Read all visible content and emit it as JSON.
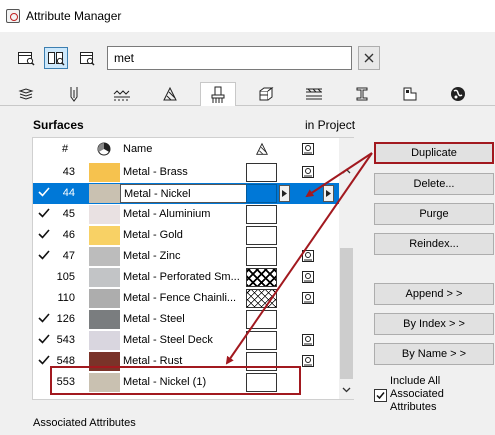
{
  "window": {
    "title": "Attribute Manager"
  },
  "toolbar": {
    "buttons": [
      {
        "icon": "left-panel-icon",
        "active": false
      },
      {
        "icon": "both-panels-icon",
        "active": true
      },
      {
        "icon": "right-panel-icon",
        "active": false
      }
    ],
    "search": {
      "value": "met",
      "placeholder": ""
    },
    "clear_icon": "close-icon"
  },
  "tabs": [
    {
      "icon": "layers-icon",
      "active": false
    },
    {
      "icon": "pens-icon",
      "active": false
    },
    {
      "icon": "line-types-icon",
      "active": false
    },
    {
      "icon": "fill-types-icon",
      "active": false
    },
    {
      "icon": "surfaces-icon",
      "active": true
    },
    {
      "icon": "building-materials-icon",
      "active": false
    },
    {
      "icon": "composites-icon",
      "active": false
    },
    {
      "icon": "profiles-icon",
      "active": false
    },
    {
      "icon": "zone-categories-icon",
      "active": false
    },
    {
      "icon": "markup-styles-icon",
      "active": false
    }
  ],
  "surfaces": {
    "heading": "Surfaces",
    "in_project_label": "in Project",
    "columns": {
      "number": "#",
      "name": "Name"
    },
    "rows": [
      {
        "checked": false,
        "number": "43",
        "name": "Metal - Brass",
        "color": "#f6c24e",
        "fill": "plain",
        "proj": true,
        "selected": false
      },
      {
        "checked": true,
        "number": "44",
        "name": "Metal - Nickel",
        "color": "#c9c1b1",
        "fill": "blue",
        "proj": false,
        "selected": true
      },
      {
        "checked": true,
        "number": "45",
        "name": "Metal - Aluminium",
        "color": "#e9e1e2",
        "fill": "plain",
        "proj": false,
        "selected": false
      },
      {
        "checked": true,
        "number": "46",
        "name": "Metal - Gold",
        "color": "#f8d165",
        "fill": "plain",
        "proj": false,
        "selected": false
      },
      {
        "checked": true,
        "number": "47",
        "name": "Metal - Zinc",
        "color": "#bcbcbc",
        "fill": "plain",
        "proj": true,
        "selected": false
      },
      {
        "checked": false,
        "number": "105",
        "name": "Metal - Perforated Sm...",
        "color": "#c2c4c6",
        "fill": "diamond",
        "proj": true,
        "selected": false
      },
      {
        "checked": false,
        "number": "110",
        "name": "Metal - Fence Chainli...",
        "color": "#adadad",
        "fill": "cross",
        "proj": true,
        "selected": false
      },
      {
        "checked": true,
        "number": "126",
        "name": "Metal - Steel",
        "color": "#7a7d7f",
        "fill": "plain",
        "proj": false,
        "selected": false
      },
      {
        "checked": true,
        "number": "543",
        "name": "Metal - Steel Deck",
        "color": "#d9d6df",
        "fill": "plain",
        "proj": true,
        "selected": false
      },
      {
        "checked": true,
        "number": "548",
        "name": "Metal - Rust",
        "color": "#7a3329",
        "fill": "plain",
        "proj": true,
        "selected": false
      },
      {
        "checked": false,
        "number": "553",
        "name": "Metal - Nickel (1)",
        "color": "#c9c1b1",
        "fill": "plain",
        "proj": false,
        "selected": false
      }
    ]
  },
  "actions": {
    "duplicate": "Duplicate",
    "delete": "Delete...",
    "purge": "Purge",
    "reindex": "Reindex...",
    "append": "Append > >",
    "by_index": "By Index > >",
    "by_name": "By Name > >"
  },
  "include_all": {
    "label": "Include All Associated Attributes",
    "checked": true
  },
  "associated_label": "Associated Attributes",
  "colors": {
    "selection": "#0078d7",
    "highlight": "#a2191f",
    "panel_bg": "#f0f0f0"
  }
}
